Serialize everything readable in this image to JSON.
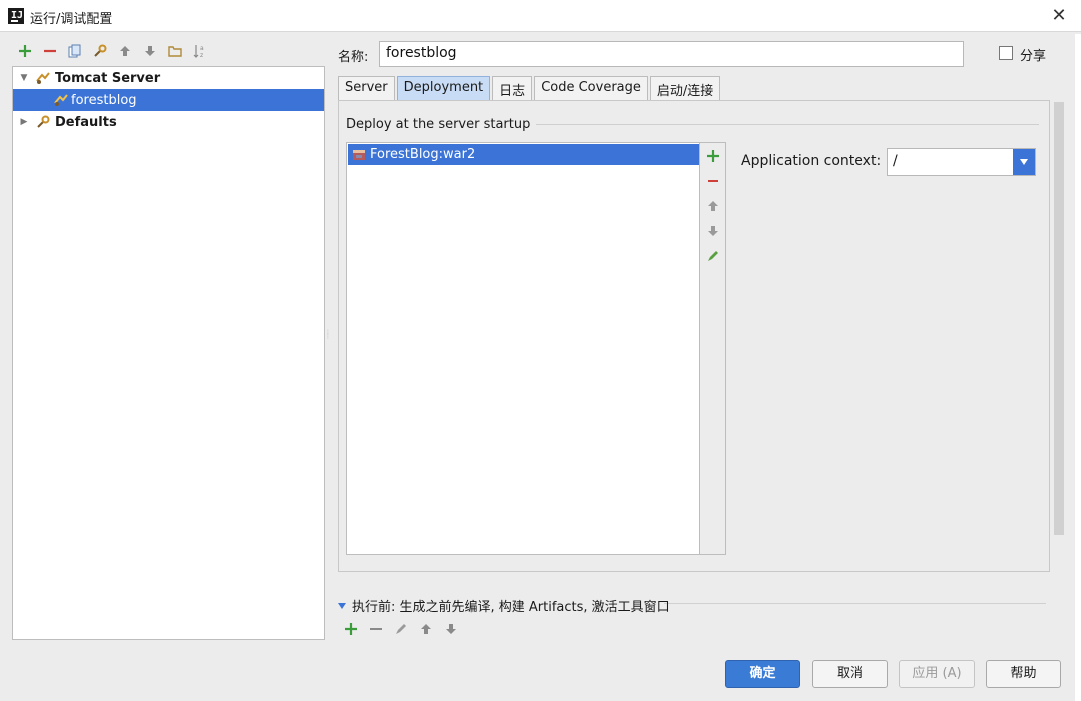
{
  "window": {
    "title": "运行/调试配置",
    "close_symbol": "✕"
  },
  "left_toolbar": {
    "icons": [
      "add-icon",
      "remove-icon",
      "copy-icon",
      "wrench-icon",
      "move-up-icon",
      "move-down-icon",
      "folder-icon",
      "sort-icon"
    ]
  },
  "tree": {
    "items": [
      {
        "label": "Tomcat Server",
        "bold": true,
        "expanded": true
      },
      {
        "label": "forestblog",
        "selected": true
      },
      {
        "label": "Defaults",
        "bold": true,
        "expanded": false
      }
    ]
  },
  "config": {
    "name_label": "名称:",
    "name_value": "forestblog",
    "share_label": "分享",
    "share_checked": false
  },
  "tabs": [
    {
      "label": "Server",
      "active": false
    },
    {
      "label": "Deployment",
      "active": true
    },
    {
      "label": "日志",
      "active": false
    },
    {
      "label": "Code Coverage",
      "active": false
    },
    {
      "label": "启动/连接",
      "active": false
    }
  ],
  "deployment": {
    "section_title": "Deploy at the server startup",
    "artifacts": [
      "ForestBlog:war2"
    ],
    "side_icons": [
      "add-icon",
      "remove-icon",
      "move-up-icon",
      "move-down-icon",
      "edit-icon"
    ],
    "app_context_label": "Application context:",
    "app_context_value": "/"
  },
  "before_launch": {
    "label": "执行前: 生成之前先编译, 构建 Artifacts, 激活工具窗口",
    "icons": [
      "add-icon",
      "remove-icon",
      "edit-icon",
      "move-up-icon",
      "move-down-icon"
    ]
  },
  "buttons": {
    "ok": "确定",
    "cancel": "取消",
    "apply": "应用 (A)",
    "help": "帮助"
  },
  "colors": {
    "selection": "#3b74d6",
    "add_green": "#3a9c3a",
    "remove_red": "#d0403a",
    "primary_button": "#3a7bd5"
  }
}
